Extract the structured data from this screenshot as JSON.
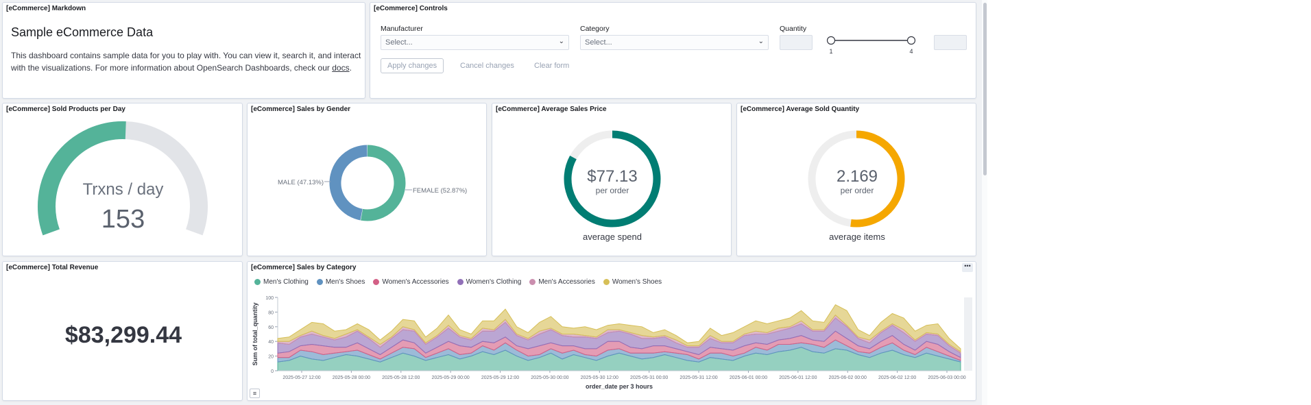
{
  "markdown": {
    "title": "[eCommerce] Markdown",
    "heading": "Sample eCommerce Data",
    "body_text": "This dashboard contains sample data for you to play with. You can view it, search it, and interact with the visualizations. For more information about OpenSearch Dashboards, check our ",
    "link_text": "docs",
    "body_end": "."
  },
  "controls": {
    "title": "[eCommerce] Controls",
    "manufacturer_label": "Manufacturer",
    "manufacturer_placeholder": "Select...",
    "category_label": "Category",
    "category_placeholder": "Select...",
    "quantity_label": "Quantity",
    "slider_min": "1",
    "slider_max": "4",
    "apply_label": "Apply changes",
    "cancel_label": "Cancel changes",
    "clear_label": "Clear form"
  },
  "sold_products": {
    "title": "[eCommerce] Sold Products per Day",
    "label": "Trxns / day",
    "value": "153",
    "fill_fraction": 0.51,
    "color": "#54b399"
  },
  "sales_gender": {
    "title": "[eCommerce] Sales by Gender",
    "male_label": "MALE (47.13%)",
    "female_label": "FEMALE (52.87%)",
    "male_pct": 47.13,
    "female_pct": 52.87,
    "male_color": "#6092c0",
    "female_color": "#54b399"
  },
  "avg_price": {
    "title": "[eCommerce] Average Sales Price",
    "value": "$77.13",
    "sub": "per order",
    "caption": "average spend",
    "fill_fraction": 0.83,
    "color": "#017d73"
  },
  "avg_qty": {
    "title": "[eCommerce] Average Sold Quantity",
    "value": "2.169",
    "sub": "per order",
    "caption": "average items",
    "fill_fraction": 0.52,
    "color": "#f5a700"
  },
  "revenue": {
    "title": "[eCommerce] Total Revenue",
    "value": "$83,299.44"
  },
  "sales_category": {
    "title": "[eCommerce] Sales by Category",
    "menu_icon": "ellipsis-icon",
    "legend_icon": "list-icon"
  },
  "chart_data": {
    "type": "area",
    "stacked": true,
    "xlabel": "order_date per 3 hours",
    "ylabel": "Sum of total_quantity",
    "ylim": [
      0,
      100
    ],
    "yticks": [
      0,
      20,
      40,
      60,
      80,
      100
    ],
    "xticks": [
      "2025-05-27 12:00",
      "2025-05-28 00:00",
      "2025-05-28 12:00",
      "2025-05-29 00:00",
      "2025-05-29 12:00",
      "2025-05-30 00:00",
      "2025-05-30 12:00",
      "2025-05-31 00:00",
      "2025-05-31 12:00",
      "2025-06-01 00:00",
      "2025-06-01 12:00",
      "2025-06-02 00:00",
      "2025-06-02 12:00",
      "2025-06-03 00:00"
    ],
    "legend_position": "top",
    "series": [
      {
        "name": "Men's Clothing",
        "color": "#54b399",
        "values": [
          12,
          14,
          20,
          16,
          14,
          18,
          22,
          20,
          16,
          12,
          18,
          24,
          20,
          14,
          18,
          22,
          16,
          20,
          26,
          22,
          28,
          20,
          14,
          18,
          24,
          16,
          22,
          18,
          14,
          20,
          24,
          20,
          16,
          18,
          22,
          18,
          14,
          12,
          18,
          16,
          14,
          20,
          24,
          22,
          26,
          28,
          32,
          26,
          24,
          30,
          28,
          22,
          18,
          24,
          28,
          22,
          18,
          24,
          20,
          16,
          12
        ]
      },
      {
        "name": "Men's Shoes",
        "color": "#6092c0",
        "values": [
          6,
          4,
          8,
          10,
          8,
          6,
          4,
          8,
          6,
          4,
          6,
          8,
          10,
          4,
          6,
          8,
          6,
          4,
          8,
          6,
          10,
          8,
          6,
          4,
          6,
          8,
          6,
          4,
          6,
          8,
          6,
          4,
          8,
          6,
          4,
          6,
          8,
          4,
          6,
          8,
          6,
          4,
          8,
          6,
          10,
          8,
          6,
          10,
          8,
          12,
          6,
          4,
          6,
          8,
          10,
          6,
          4,
          8,
          6,
          4,
          2
        ]
      },
      {
        "name": "Women's Accessories",
        "color": "#d36086",
        "values": [
          6,
          8,
          6,
          10,
          12,
          8,
          6,
          10,
          8,
          6,
          8,
          10,
          8,
          6,
          8,
          10,
          12,
          8,
          6,
          10,
          8,
          6,
          10,
          12,
          8,
          10,
          6,
          8,
          10,
          12,
          10,
          8,
          6,
          10,
          8,
          6,
          4,
          6,
          8,
          6,
          8,
          10,
          6,
          8,
          6,
          8,
          10,
          6,
          8,
          12,
          10,
          8,
          6,
          8,
          10,
          8,
          6,
          8,
          10,
          6,
          4
        ]
      },
      {
        "name": "Women's Clothing",
        "color": "#9170b8",
        "values": [
          14,
          10,
          12,
          14,
          12,
          10,
          14,
          16,
          14,
          10,
          12,
          14,
          16,
          12,
          14,
          18,
          12,
          10,
          14,
          16,
          20,
          14,
          12,
          16,
          18,
          14,
          12,
          16,
          14,
          12,
          14,
          18,
          14,
          10,
          12,
          8,
          6,
          10,
          12,
          8,
          10,
          14,
          12,
          14,
          12,
          14,
          16,
          12,
          14,
          18,
          16,
          10,
          8,
          12,
          14,
          16,
          12,
          10,
          12,
          8,
          6
        ]
      },
      {
        "name": "Men's Accessories",
        "color": "#ca8eae",
        "values": [
          2,
          4,
          2,
          4,
          2,
          2,
          4,
          2,
          2,
          4,
          2,
          4,
          2,
          2,
          2,
          4,
          2,
          2,
          4,
          2,
          4,
          2,
          2,
          4,
          2,
          2,
          4,
          2,
          2,
          4,
          2,
          2,
          4,
          2,
          2,
          4,
          2,
          2,
          4,
          2,
          2,
          2,
          4,
          2,
          4,
          2,
          4,
          2,
          2,
          4,
          2,
          2,
          4,
          2,
          2,
          4,
          2,
          2,
          2,
          2,
          2
        ]
      },
      {
        "name": "Women's Shoes",
        "color": "#d6bf57",
        "values": [
          4,
          6,
          8,
          12,
          16,
          10,
          6,
          8,
          10,
          6,
          8,
          10,
          12,
          8,
          10,
          14,
          8,
          6,
          10,
          12,
          14,
          10,
          8,
          12,
          16,
          10,
          8,
          12,
          10,
          6,
          8,
          10,
          12,
          6,
          8,
          6,
          4,
          6,
          10,
          8,
          12,
          10,
          14,
          12,
          10,
          12,
          14,
          12,
          10,
          14,
          20,
          10,
          6,
          12,
          14,
          16,
          12,
          10,
          14,
          8,
          4
        ]
      }
    ]
  }
}
